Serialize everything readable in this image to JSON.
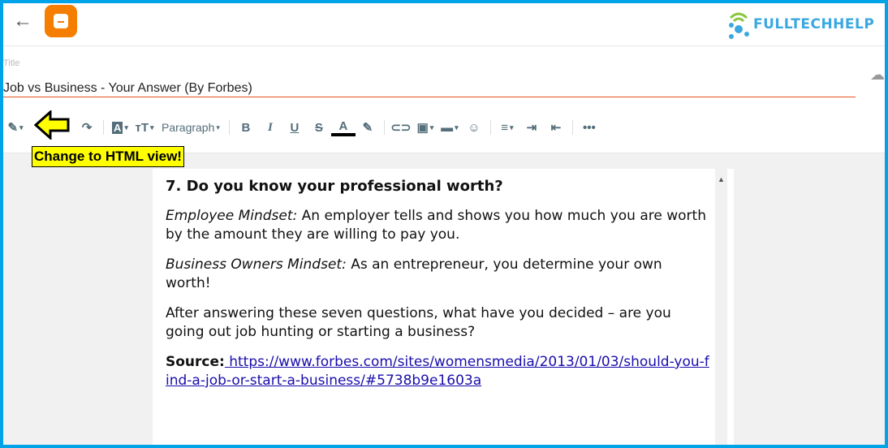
{
  "header": {
    "back_icon": "arrow-left-icon",
    "logo": "blogger-logo",
    "watermark": "FULLTECHHELP"
  },
  "title": {
    "label": "Title",
    "value": "Job vs Business - Your Answer (By Forbes)"
  },
  "toolbar": {
    "paragraph": "Paragraph",
    "more": "•••"
  },
  "annotation": {
    "callout": "Change to HTML view!",
    "arrow_color": "#ffff00"
  },
  "content": {
    "heading": "7. Do you know your professional worth?",
    "p1_em": "Employee Mindset:",
    "p1": " An employer tells and shows you how much you are worth by the amount they are willing to pay you.",
    "p2_em": "Business Owners Mindset:",
    "p2": " As an entrepreneur, you determine your own worth!",
    "p3": "After answering these seven questions, what have you decided – are you going out job hunting or starting a business?",
    "source_label": "Source:",
    "source_link": " https://www.forbes.com/sites/womensmedia/2013/01/03/should-you-find-a-job-or-start-a-business/#5738b9e1603a "
  },
  "colors": {
    "border": "#00a2e8",
    "accent": "#e8541c",
    "blogger": "#f57d00"
  }
}
